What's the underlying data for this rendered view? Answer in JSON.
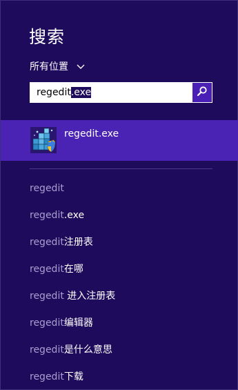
{
  "pane": {
    "title": "搜索",
    "scope_label": "所有位置"
  },
  "search": {
    "query_plain": "regedit",
    "query_selected": ".exe"
  },
  "top_result": {
    "label": "regedit.exe",
    "icon": "registry-editor-icon"
  },
  "suggestions": [
    {
      "query": "regedit",
      "suffix": ""
    },
    {
      "query": "regedit",
      "suffix": ".exe"
    },
    {
      "query": "regedit",
      "suffix": "注册表"
    },
    {
      "query": "regedit",
      "suffix": "在哪"
    },
    {
      "query": "regedit",
      "suffix": " 进入注册表"
    },
    {
      "query": "regedit",
      "suffix": "编辑器"
    },
    {
      "query": "regedit",
      "suffix": "是什么意思"
    },
    {
      "query": "regedit",
      "suffix": "下载"
    }
  ],
  "colors": {
    "background": "#1e0b5c",
    "highlight": "#4a22b4",
    "search_button": "#4a1fb6",
    "muted_text": "#a89ed0"
  }
}
